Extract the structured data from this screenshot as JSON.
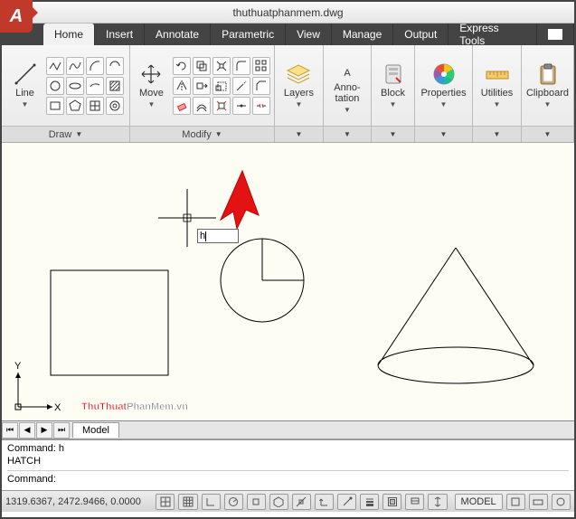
{
  "title": {
    "file": "thuthuatphanmem.dwg",
    "app_letter": "A"
  },
  "tabs": {
    "home": "Home",
    "insert": "Insert",
    "annotate": "Annotate",
    "parametric": "Parametric",
    "view": "View",
    "manage": "Manage",
    "output": "Output",
    "express": "Express Tools"
  },
  "ribbon": {
    "draw": {
      "title": "Draw",
      "line": "Line"
    },
    "modify": {
      "title": "Modify",
      "move": "Move"
    },
    "layers": "Layers",
    "annotation": "Anno-\ntation",
    "block": "Block",
    "properties": "Properties",
    "utilities": "Utilities",
    "clipboard": "Clipboard"
  },
  "canvas": {
    "input_value": "h",
    "ucs": {
      "x": "X",
      "y": "Y"
    }
  },
  "model_tabs": {
    "model": "Model"
  },
  "commandline": {
    "l1": "Command: h",
    "l2": "HATCH",
    "l3": "Command:"
  },
  "status": {
    "coords": "1319.6367, 2472.9466, 0.0000",
    "model": "MODEL"
  },
  "watermark": {
    "bold": "ThuThuat",
    "tail": "PhanMem.vn"
  },
  "chart_data": null
}
